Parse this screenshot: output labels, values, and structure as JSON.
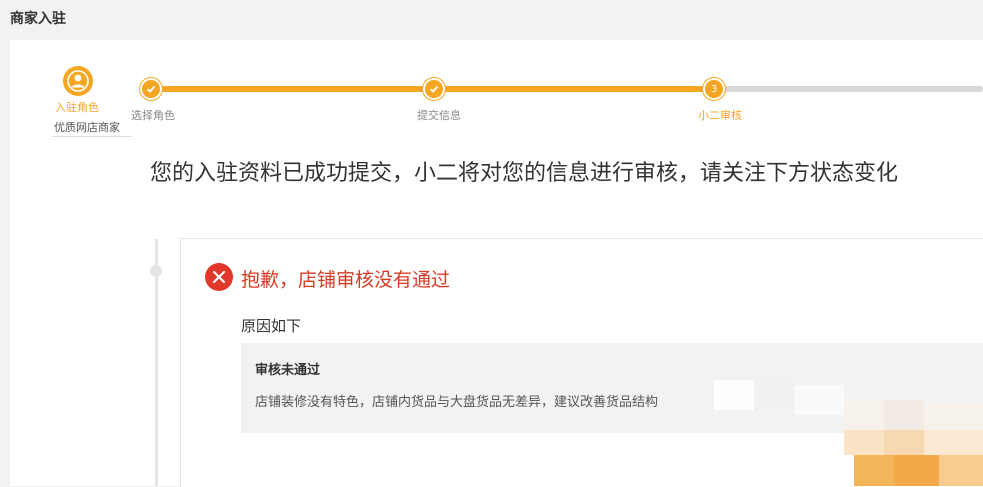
{
  "header": {
    "title": "商家入驻"
  },
  "role": {
    "label": "入驻角色",
    "subtitle": "优质网店商家"
  },
  "steps": [
    {
      "label": "选择角色",
      "state": "done"
    },
    {
      "label": "提交信息",
      "state": "done"
    },
    {
      "label": "小二审核",
      "state": "active",
      "number": "3"
    }
  ],
  "progress_fraction": 0.68,
  "message": {
    "headline": "您的入驻资料已成功提交，小二将对您的信息进行审核，请关注下方状态变化"
  },
  "result": {
    "title": "抱歉，店铺审核没有通过",
    "reason_heading": "原因如下",
    "reason_title": "审核未通过",
    "reason_text": "店铺装修没有特色，店铺内货品与大盘货品无差异，建议改善货品结构"
  },
  "colors": {
    "accent": "#f5a623",
    "error": "#e2372a",
    "error_text": "#d93a24",
    "track": "#d8d8d8"
  },
  "icons": {
    "role": "user-icon",
    "done_step": "check-icon",
    "fail": "close-icon"
  }
}
